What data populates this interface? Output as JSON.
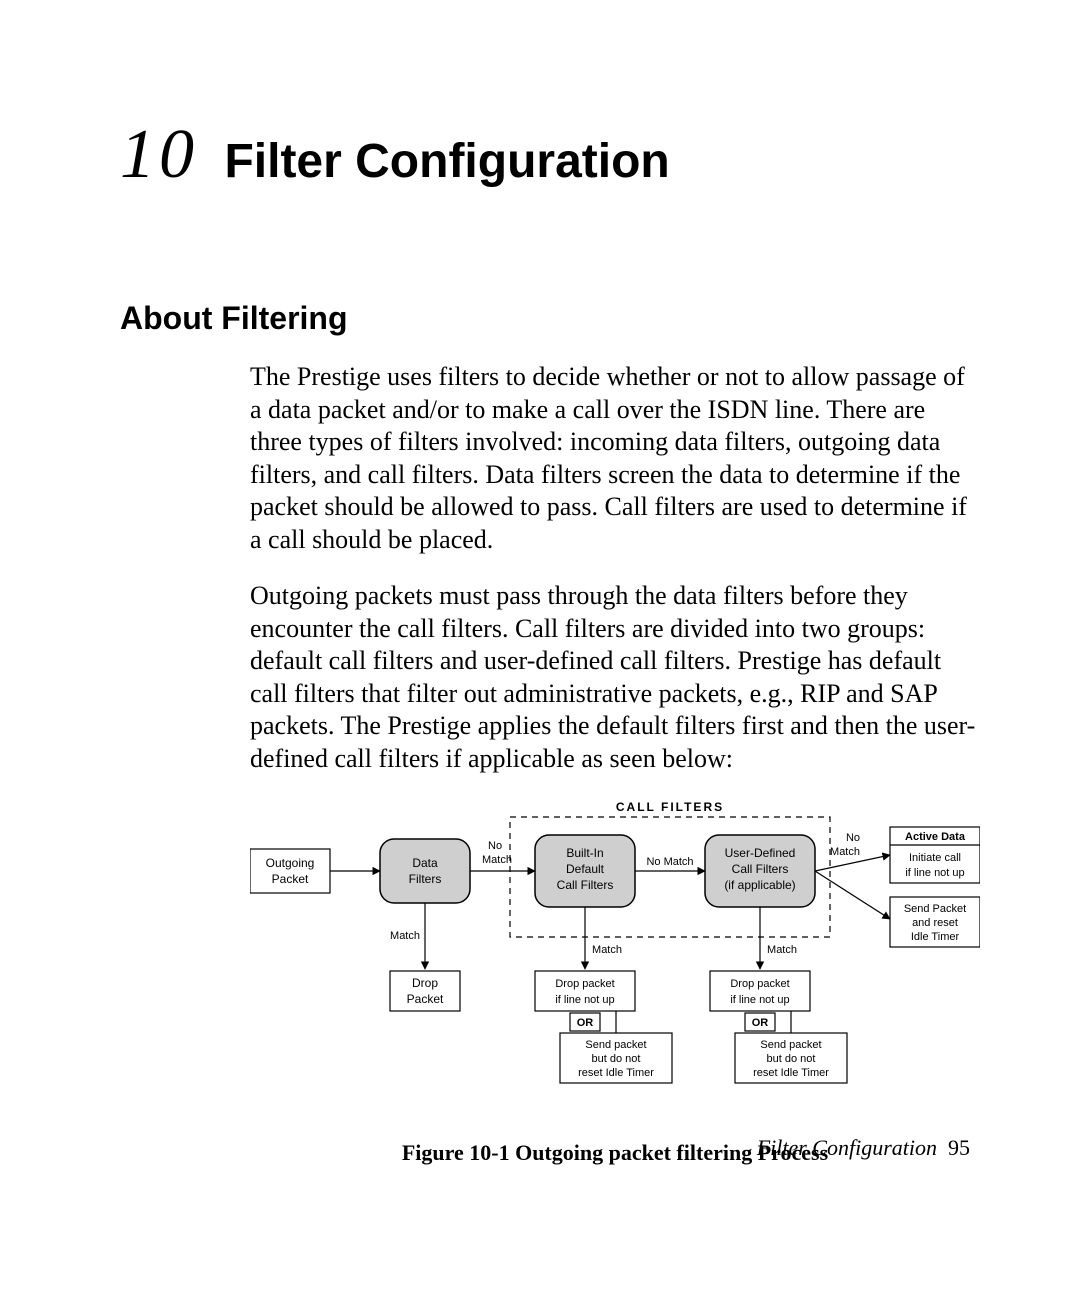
{
  "chapter": {
    "number": "10",
    "title": "Filter Configuration"
  },
  "section": {
    "heading": "About Filtering",
    "para1": "The Prestige uses filters to decide whether or not to allow passage of a data packet and/or to make a call over the ISDN line. There are three types of filters involved: incoming data filters, outgoing data filters, and call filters. Data filters screen the data to determine if the packet should be allowed to pass. Call filters are used to determine if a call should be placed.",
    "para2": "Outgoing packets must pass through the data filters before they encounter the call filters. Call filters are divided into two groups: default call filters and user-defined call filters. Prestige has default call filters that filter out administrative packets, e.g., RIP and SAP packets. The Prestige applies the default filters first and then the user-defined call filters if applicable as seen below:"
  },
  "diagram": {
    "header": "CALL  FILTERS",
    "boxes": {
      "outgoing_packet": [
        "Outgoing",
        "Packet"
      ],
      "data_filters": [
        "Data",
        "Filters"
      ],
      "builtin_default": [
        "Built-In",
        "Default",
        "Call Filters"
      ],
      "user_defined": [
        "User-Defined",
        "Call Filters",
        "(if applicable)"
      ],
      "active_data_header": "Active Data",
      "active_data": [
        "Initiate call",
        "if line not up"
      ],
      "send_reset": [
        "Send Packet",
        "and reset",
        "Idle Timer"
      ],
      "drop_packet": [
        "Drop",
        "Packet"
      ],
      "drop_if_not_up_1": [
        "Drop packet",
        "if line not up"
      ],
      "drop_if_not_up_2": [
        "Drop packet",
        "if line not up"
      ],
      "or_1": "OR",
      "or_2": "OR",
      "send_no_reset_1": [
        "Send packet",
        "but do not",
        "reset Idle Timer"
      ],
      "send_no_reset_2": [
        "Send packet",
        "but do not",
        "reset Idle Timer"
      ]
    },
    "labels": {
      "no_match_1": [
        "No",
        "Match"
      ],
      "no_match_2": "No Match",
      "no_match_3": [
        "No",
        "Match"
      ],
      "match_1": "Match",
      "match_2": "Match",
      "match_3": "Match"
    }
  },
  "figure_caption": "Figure 10-1 Outgoing packet filtering Process",
  "footer": {
    "text": "Filter Configuration",
    "page": "95"
  }
}
